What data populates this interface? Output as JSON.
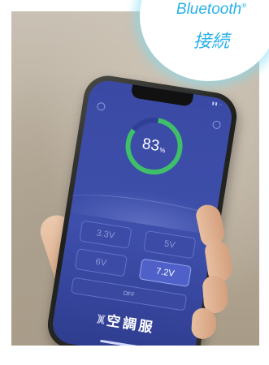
{
  "badge": {
    "line1": "Bluetooth",
    "registered": "®",
    "line2": "接続"
  },
  "app": {
    "battery": {
      "value": "83",
      "unit": "%",
      "fraction": 0.83,
      "track_color": "#2f3f96",
      "fill_color": "#3fbf6a"
    },
    "voltage_buttons": [
      {
        "label": "3.3V",
        "active": false
      },
      {
        "label": "5V",
        "active": false
      },
      {
        "label": "6V",
        "active": false
      },
      {
        "label": "7.2V",
        "active": true
      }
    ],
    "off_label": "OFF",
    "logo_text": "空調服"
  },
  "colors": {
    "screen_bg": "#3e4fab",
    "accent": "#2ab1e6"
  }
}
